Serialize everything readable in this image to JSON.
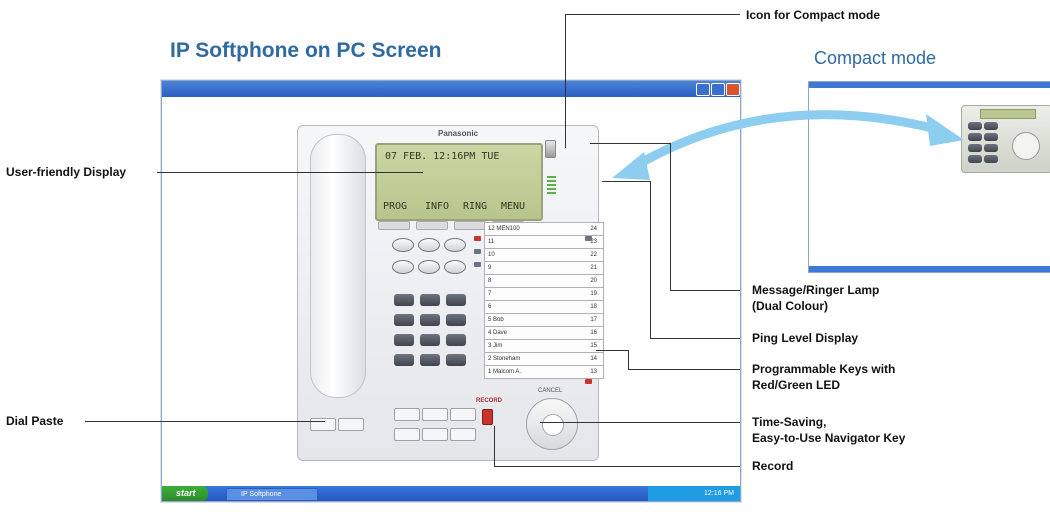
{
  "titles": {
    "main": "IP Softphone on PC Screen",
    "compact": "Compact mode"
  },
  "callouts": {
    "compact_icon": "Icon for Compact mode",
    "display": "User-friendly Display",
    "lamp_line1": "Message/Ringer Lamp",
    "lamp_line2": "(Dual Colour)",
    "ping": "Ping Level Display",
    "prog_line1": "Programmable Keys with",
    "prog_line2": "Red/Green LED",
    "dial_paste": "Dial Paste",
    "nav_line1": "Time-Saving,",
    "nav_line2": "Easy-to-Use Navigator Key",
    "record": "Record"
  },
  "phone": {
    "brand": "Panasonic",
    "lcd_line1": "07 FEB. 12:16PM  TUE",
    "softkeys": [
      "PROG",
      "INFO",
      "RING",
      "MENU"
    ],
    "record_label": "RECORD",
    "nav_label": "CANCEL",
    "left_keys": [
      "12 MEN100",
      "11",
      "10",
      "9",
      "8",
      "7",
      "6",
      "5  Bob",
      "4  Dave",
      "3  Jim",
      "2  Stoneham",
      "1  Malcom A."
    ],
    "right_keys": [
      "24",
      "23",
      "22",
      "21",
      "20",
      "19",
      "18",
      "17",
      "16",
      "15",
      "14",
      "13"
    ]
  },
  "pc": {
    "taskbar_start": "start",
    "taskbar_item": "IP Softphone",
    "clock": "12:16 PM"
  },
  "icons": {
    "arrow": "double-headed-curved-arrow-icon",
    "start": "windows-start-icon"
  },
  "colors": {
    "title_blue": "#2f6aa1",
    "arrow_blue": "#8ccdf0",
    "lcd_green": "#c9d7a4",
    "led_red": "#c8352c"
  }
}
